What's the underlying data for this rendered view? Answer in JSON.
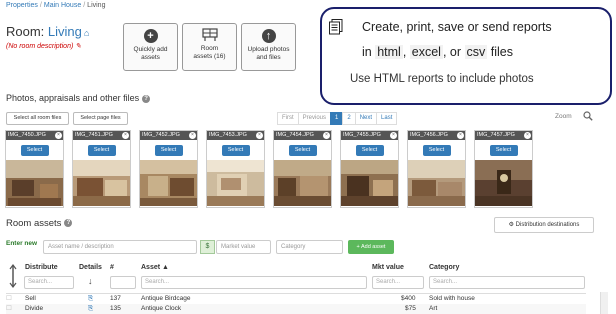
{
  "breadcrumb": [
    "Properties",
    "Main House",
    "Living"
  ],
  "room": {
    "label": "Room:",
    "name": "Living",
    "description": "(No room description)"
  },
  "quick_buttons": [
    {
      "label1": "Quickly add",
      "label2": "assets",
      "icon": "plus-icon"
    },
    {
      "label1": "Room",
      "label2": "assets (16)",
      "icon": "table-icon"
    },
    {
      "label1": "Upload photos",
      "label2": "and files",
      "icon": "upload-icon"
    }
  ],
  "callout": {
    "line1": "Create, print, save or send reports",
    "line2_pre": "in ",
    "fmt1": "html",
    "sep1": ", ",
    "fmt2": "excel",
    "sep2": ", or ",
    "fmt3": "csv",
    "line2_post": " files",
    "line3": "Use HTML reports to include photos"
  },
  "photos_section": {
    "title": "Photos, appraisals and other files",
    "select_all": "Select all room files",
    "select_page": "Select page files",
    "zoom_label": "Zoom"
  },
  "pager": [
    "First",
    "Previous",
    "1",
    "2",
    "Next",
    "Last"
  ],
  "photos": [
    {
      "name": "IMG_7450.JPG",
      "select": "Select"
    },
    {
      "name": "IMG_7451.JPG",
      "select": "Select"
    },
    {
      "name": "IMG_7452.JPG",
      "select": "Select"
    },
    {
      "name": "IMG_7453.JPG",
      "select": "Select"
    },
    {
      "name": "IMG_7454.JPG",
      "select": "Select"
    },
    {
      "name": "IMG_7455.JPG",
      "select": "Select"
    },
    {
      "name": "IMG_7456.JPG",
      "select": "Select"
    },
    {
      "name": "IMG_7457.JPG",
      "select": "Select"
    }
  ],
  "assets_section": {
    "title": "Room assets",
    "dist_button": "Distribution destinations",
    "enter_new": "Enter new",
    "name_placeholder": "Asset name / description",
    "dollar": "$",
    "value_placeholder": "Market value",
    "category_placeholder": "Category",
    "add_button": "+ Add asset"
  },
  "table": {
    "headers": {
      "distribute": "Distribute",
      "details": "Details",
      "num": "#",
      "asset": "Asset ▲",
      "value": "Mkt value",
      "category": "Category"
    },
    "search_placeholder": "Search...",
    "rows": [
      {
        "distribute": "Sell",
        "num": "137",
        "asset": "Antique Birdcage",
        "value": "$400",
        "category": "Sold with house"
      },
      {
        "distribute": "Divide",
        "num": "135",
        "asset": "Antique Clock",
        "value": "$75",
        "category": "Art"
      }
    ]
  },
  "colors": {
    "accent": "#337ab7",
    "callout_border": "#1a1f6b",
    "add_green": "#5cb85c"
  }
}
